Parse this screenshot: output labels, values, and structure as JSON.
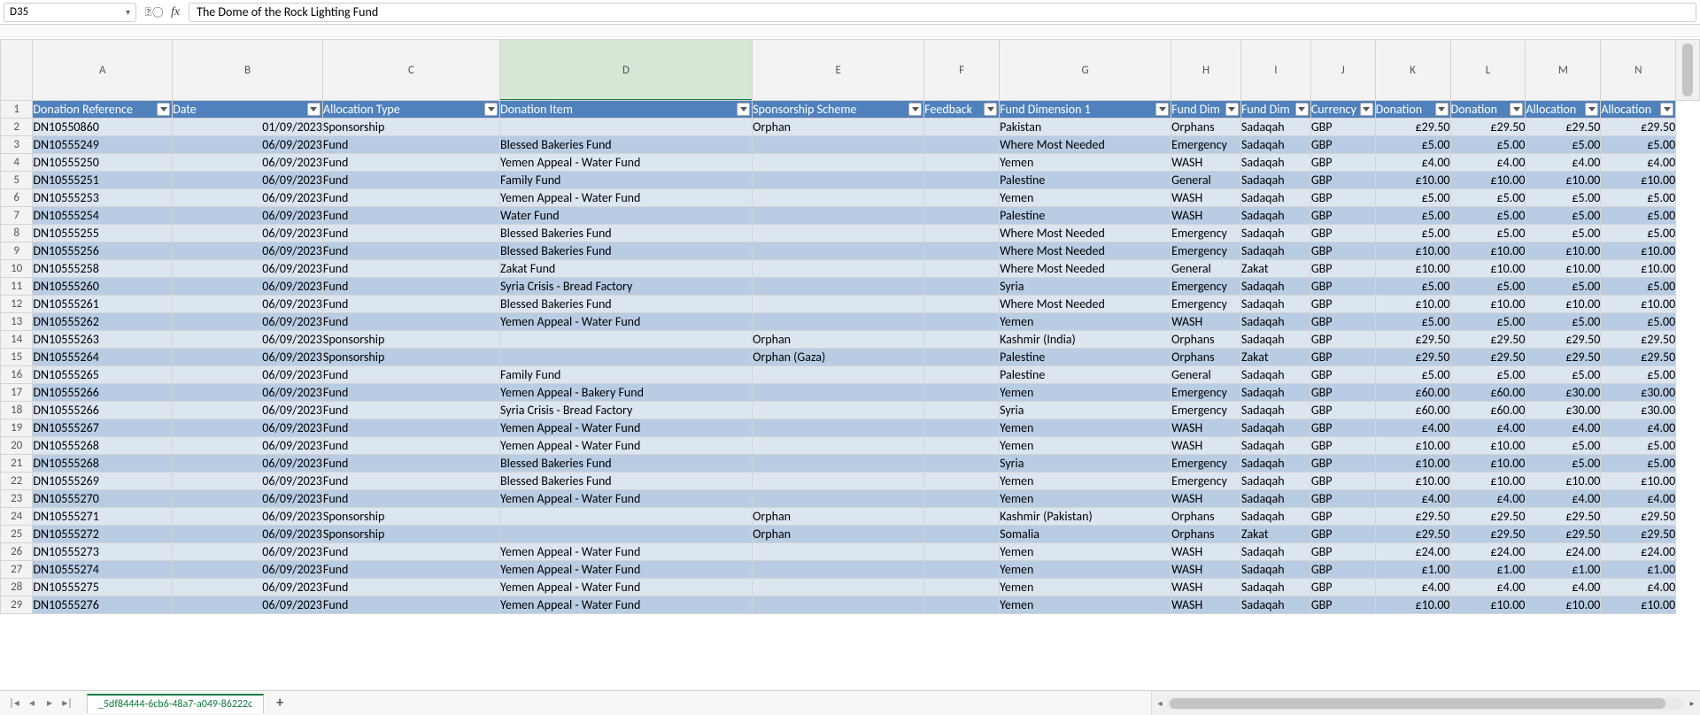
{
  "nameBox": "D35",
  "formulaBar": "The Dome of the Rock Lighting Fund",
  "columnLetters": [
    "A",
    "B",
    "C",
    "D",
    "E",
    "F",
    "G",
    "H",
    "I",
    "J",
    "K",
    "L",
    "M",
    "N"
  ],
  "selectedColumnIndex": 3,
  "headers": [
    "Donation Reference",
    "Date",
    "Allocation Type",
    "Donation Item",
    "Sponsorship Scheme",
    "Feedback",
    "Fund Dimension 1",
    "Fund Dim",
    "Fund Dim",
    "Currency",
    "Donation",
    "Donation",
    "Allocation",
    "Allocation"
  ],
  "rows": [
    {
      "n": 2,
      "ref": "DN10550860",
      "date": "01/09/2023",
      "alloc": "Sponsorship",
      "item": "",
      "scheme": "Orphan",
      "fb": "",
      "fd1": "Pakistan",
      "fd2": "Orphans",
      "fd3": "Sadaqah",
      "cur": "GBP",
      "d1": "£29.50",
      "d2": "£29.50",
      "a1": "£29.50",
      "a2": "£29.50"
    },
    {
      "n": 3,
      "ref": "DN10555249",
      "date": "06/09/2023",
      "alloc": "Fund",
      "item": "Blessed Bakeries Fund",
      "scheme": "",
      "fb": "",
      "fd1": "Where Most Needed",
      "fd2": "Emergency",
      "fd3": "Sadaqah",
      "cur": "GBP",
      "d1": "£5.00",
      "d2": "£5.00",
      "a1": "£5.00",
      "a2": "£5.00"
    },
    {
      "n": 4,
      "ref": "DN10555250",
      "date": "06/09/2023",
      "alloc": "Fund",
      "item": "Yemen Appeal - Water Fund",
      "scheme": "",
      "fb": "",
      "fd1": "Yemen",
      "fd2": "WASH",
      "fd3": "Sadaqah",
      "cur": "GBP",
      "d1": "£4.00",
      "d2": "£4.00",
      "a1": "£4.00",
      "a2": "£4.00"
    },
    {
      "n": 5,
      "ref": "DN10555251",
      "date": "06/09/2023",
      "alloc": "Fund",
      "item": "Family Fund",
      "scheme": "",
      "fb": "",
      "fd1": "Palestine",
      "fd2": "General",
      "fd3": "Sadaqah",
      "cur": "GBP",
      "d1": "£10.00",
      "d2": "£10.00",
      "a1": "£10.00",
      "a2": "£10.00"
    },
    {
      "n": 6,
      "ref": "DN10555253",
      "date": "06/09/2023",
      "alloc": "Fund",
      "item": "Yemen Appeal - Water Fund",
      "scheme": "",
      "fb": "",
      "fd1": "Yemen",
      "fd2": "WASH",
      "fd3": "Sadaqah",
      "cur": "GBP",
      "d1": "£5.00",
      "d2": "£5.00",
      "a1": "£5.00",
      "a2": "£5.00"
    },
    {
      "n": 7,
      "ref": "DN10555254",
      "date": "06/09/2023",
      "alloc": "Fund",
      "item": "Water Fund",
      "scheme": "",
      "fb": "",
      "fd1": "Palestine",
      "fd2": "WASH",
      "fd3": "Sadaqah",
      "cur": "GBP",
      "d1": "£5.00",
      "d2": "£5.00",
      "a1": "£5.00",
      "a2": "£5.00"
    },
    {
      "n": 8,
      "ref": "DN10555255",
      "date": "06/09/2023",
      "alloc": "Fund",
      "item": "Blessed Bakeries Fund",
      "scheme": "",
      "fb": "",
      "fd1": "Where Most Needed",
      "fd2": "Emergency",
      "fd3": "Sadaqah",
      "cur": "GBP",
      "d1": "£5.00",
      "d2": "£5.00",
      "a1": "£5.00",
      "a2": "£5.00"
    },
    {
      "n": 9,
      "ref": "DN10555256",
      "date": "06/09/2023",
      "alloc": "Fund",
      "item": "Blessed Bakeries Fund",
      "scheme": "",
      "fb": "",
      "fd1": "Where Most Needed",
      "fd2": "Emergency",
      "fd3": "Sadaqah",
      "cur": "GBP",
      "d1": "£10.00",
      "d2": "£10.00",
      "a1": "£10.00",
      "a2": "£10.00"
    },
    {
      "n": 10,
      "ref": "DN10555258",
      "date": "06/09/2023",
      "alloc": "Fund",
      "item": "Zakat Fund",
      "scheme": "",
      "fb": "",
      "fd1": "Where Most Needed",
      "fd2": "General",
      "fd3": "Zakat",
      "cur": "GBP",
      "d1": "£10.00",
      "d2": "£10.00",
      "a1": "£10.00",
      "a2": "£10.00"
    },
    {
      "n": 11,
      "ref": "DN10555260",
      "date": "06/09/2023",
      "alloc": "Fund",
      "item": "Syria Crisis - Bread Factory",
      "scheme": "",
      "fb": "",
      "fd1": "Syria",
      "fd2": "Emergency",
      "fd3": "Sadaqah",
      "cur": "GBP",
      "d1": "£5.00",
      "d2": "£5.00",
      "a1": "£5.00",
      "a2": "£5.00"
    },
    {
      "n": 12,
      "ref": "DN10555261",
      "date": "06/09/2023",
      "alloc": "Fund",
      "item": "Blessed Bakeries Fund",
      "scheme": "",
      "fb": "",
      "fd1": "Where Most Needed",
      "fd2": "Emergency",
      "fd3": "Sadaqah",
      "cur": "GBP",
      "d1": "£10.00",
      "d2": "£10.00",
      "a1": "£10.00",
      "a2": "£10.00"
    },
    {
      "n": 13,
      "ref": "DN10555262",
      "date": "06/09/2023",
      "alloc": "Fund",
      "item": "Yemen Appeal - Water Fund",
      "scheme": "",
      "fb": "",
      "fd1": "Yemen",
      "fd2": "WASH",
      "fd3": "Sadaqah",
      "cur": "GBP",
      "d1": "£5.00",
      "d2": "£5.00",
      "a1": "£5.00",
      "a2": "£5.00"
    },
    {
      "n": 14,
      "ref": "DN10555263",
      "date": "06/09/2023",
      "alloc": "Sponsorship",
      "item": "",
      "scheme": "Orphan",
      "fb": "",
      "fd1": "Kashmir (India)",
      "fd2": "Orphans",
      "fd3": "Sadaqah",
      "cur": "GBP",
      "d1": "£29.50",
      "d2": "£29.50",
      "a1": "£29.50",
      "a2": "£29.50"
    },
    {
      "n": 15,
      "ref": "DN10555264",
      "date": "06/09/2023",
      "alloc": "Sponsorship",
      "item": "",
      "scheme": "Orphan (Gaza)",
      "fb": "",
      "fd1": "Palestine",
      "fd2": "Orphans",
      "fd3": "Zakat",
      "cur": "GBP",
      "d1": "£29.50",
      "d2": "£29.50",
      "a1": "£29.50",
      "a2": "£29.50"
    },
    {
      "n": 16,
      "ref": "DN10555265",
      "date": "06/09/2023",
      "alloc": "Fund",
      "item": "Family Fund",
      "scheme": "",
      "fb": "",
      "fd1": "Palestine",
      "fd2": "General",
      "fd3": "Sadaqah",
      "cur": "GBP",
      "d1": "£5.00",
      "d2": "£5.00",
      "a1": "£5.00",
      "a2": "£5.00"
    },
    {
      "n": 17,
      "ref": "DN10555266",
      "date": "06/09/2023",
      "alloc": "Fund",
      "item": "Yemen Appeal - Bakery Fund",
      "scheme": "",
      "fb": "",
      "fd1": "Yemen",
      "fd2": "Emergency",
      "fd3": "Sadaqah",
      "cur": "GBP",
      "d1": "£60.00",
      "d2": "£60.00",
      "a1": "£30.00",
      "a2": "£30.00"
    },
    {
      "n": 18,
      "ref": "DN10555266",
      "date": "06/09/2023",
      "alloc": "Fund",
      "item": "Syria Crisis - Bread Factory",
      "scheme": "",
      "fb": "",
      "fd1": "Syria",
      "fd2": "Emergency",
      "fd3": "Sadaqah",
      "cur": "GBP",
      "d1": "£60.00",
      "d2": "£60.00",
      "a1": "£30.00",
      "a2": "£30.00"
    },
    {
      "n": 19,
      "ref": "DN10555267",
      "date": "06/09/2023",
      "alloc": "Fund",
      "item": "Yemen Appeal - Water Fund",
      "scheme": "",
      "fb": "",
      "fd1": "Yemen",
      "fd2": "WASH",
      "fd3": "Sadaqah",
      "cur": "GBP",
      "d1": "£4.00",
      "d2": "£4.00",
      "a1": "£4.00",
      "a2": "£4.00"
    },
    {
      "n": 20,
      "ref": "DN10555268",
      "date": "06/09/2023",
      "alloc": "Fund",
      "item": "Yemen Appeal - Water Fund",
      "scheme": "",
      "fb": "",
      "fd1": "Yemen",
      "fd2": "WASH",
      "fd3": "Sadaqah",
      "cur": "GBP",
      "d1": "£10.00",
      "d2": "£10.00",
      "a1": "£5.00",
      "a2": "£5.00"
    },
    {
      "n": 21,
      "ref": "DN10555268",
      "date": "06/09/2023",
      "alloc": "Fund",
      "item": "Blessed Bakeries Fund",
      "scheme": "",
      "fb": "",
      "fd1": "Syria",
      "fd2": "Emergency",
      "fd3": "Sadaqah",
      "cur": "GBP",
      "d1": "£10.00",
      "d2": "£10.00",
      "a1": "£5.00",
      "a2": "£5.00"
    },
    {
      "n": 22,
      "ref": "DN10555269",
      "date": "06/09/2023",
      "alloc": "Fund",
      "item": "Blessed Bakeries Fund",
      "scheme": "",
      "fb": "",
      "fd1": "Yemen",
      "fd2": "Emergency",
      "fd3": "Sadaqah",
      "cur": "GBP",
      "d1": "£10.00",
      "d2": "£10.00",
      "a1": "£10.00",
      "a2": "£10.00"
    },
    {
      "n": 23,
      "ref": "DN10555270",
      "date": "06/09/2023",
      "alloc": "Fund",
      "item": "Yemen Appeal - Water Fund",
      "scheme": "",
      "fb": "",
      "fd1": "Yemen",
      "fd2": "WASH",
      "fd3": "Sadaqah",
      "cur": "GBP",
      "d1": "£4.00",
      "d2": "£4.00",
      "a1": "£4.00",
      "a2": "£4.00"
    },
    {
      "n": 24,
      "ref": "DN10555271",
      "date": "06/09/2023",
      "alloc": "Sponsorship",
      "item": "",
      "scheme": "Orphan",
      "fb": "",
      "fd1": "Kashmir (Pakistan)",
      "fd2": "Orphans",
      "fd3": "Sadaqah",
      "cur": "GBP",
      "d1": "£29.50",
      "d2": "£29.50",
      "a1": "£29.50",
      "a2": "£29.50"
    },
    {
      "n": 25,
      "ref": "DN10555272",
      "date": "06/09/2023",
      "alloc": "Sponsorship",
      "item": "",
      "scheme": "Orphan",
      "fb": "",
      "fd1": "Somalia",
      "fd2": "Orphans",
      "fd3": "Zakat",
      "cur": "GBP",
      "d1": "£29.50",
      "d2": "£29.50",
      "a1": "£29.50",
      "a2": "£29.50"
    },
    {
      "n": 26,
      "ref": "DN10555273",
      "date": "06/09/2023",
      "alloc": "Fund",
      "item": "Yemen Appeal - Water Fund",
      "scheme": "",
      "fb": "",
      "fd1": "Yemen",
      "fd2": "WASH",
      "fd3": "Sadaqah",
      "cur": "GBP",
      "d1": "£24.00",
      "d2": "£24.00",
      "a1": "£24.00",
      "a2": "£24.00"
    },
    {
      "n": 27,
      "ref": "DN10555274",
      "date": "06/09/2023",
      "alloc": "Fund",
      "item": "Yemen Appeal - Water Fund",
      "scheme": "",
      "fb": "",
      "fd1": "Yemen",
      "fd2": "WASH",
      "fd3": "Sadaqah",
      "cur": "GBP",
      "d1": "£1.00",
      "d2": "£1.00",
      "a1": "£1.00",
      "a2": "£1.00"
    },
    {
      "n": 28,
      "ref": "DN10555275",
      "date": "06/09/2023",
      "alloc": "Fund",
      "item": "Yemen Appeal - Water Fund",
      "scheme": "",
      "fb": "",
      "fd1": "Yemen",
      "fd2": "WASH",
      "fd3": "Sadaqah",
      "cur": "GBP",
      "d1": "£4.00",
      "d2": "£4.00",
      "a1": "£4.00",
      "a2": "£4.00"
    },
    {
      "n": 29,
      "ref": "DN10555276",
      "date": "06/09/2023",
      "alloc": "Fund",
      "item": "Yemen Appeal - Water Fund",
      "scheme": "",
      "fb": "",
      "fd1": "Yemen",
      "fd2": "WASH",
      "fd3": "Sadaqah",
      "cur": "GBP",
      "d1": "£10.00",
      "d2": "£10.00",
      "a1": "£10.00",
      "a2": "£10.00"
    }
  ],
  "sheetTab": "_5df84444-6cb6-48a7-a049-86222c",
  "navIcons": {
    "first": "|◂",
    "prev": "◂",
    "next": "▸",
    "last": "▸|"
  },
  "addSheet": "+"
}
